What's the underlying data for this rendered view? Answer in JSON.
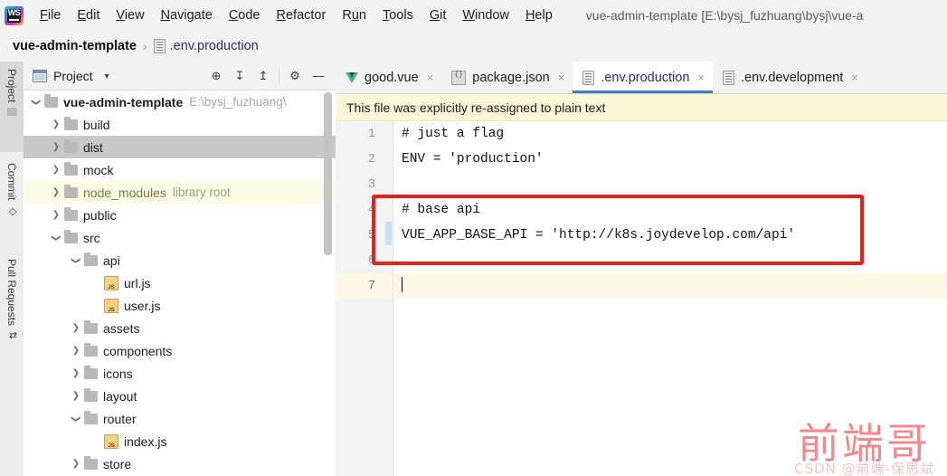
{
  "window": {
    "title": "vue-admin-template [E:\\bysj_fuzhuang\\bysj\\vue-a",
    "app_icon": "webstorm-icon"
  },
  "menubar": {
    "items": [
      {
        "label": "File",
        "mnemonic": "F"
      },
      {
        "label": "Edit",
        "mnemonic": "E"
      },
      {
        "label": "View",
        "mnemonic": "V"
      },
      {
        "label": "Navigate",
        "mnemonic": "N"
      },
      {
        "label": "Code",
        "mnemonic": "C"
      },
      {
        "label": "Refactor",
        "mnemonic": "R"
      },
      {
        "label": "Run",
        "mnemonic": "u"
      },
      {
        "label": "Tools",
        "mnemonic": "T"
      },
      {
        "label": "Git",
        "mnemonic": "G"
      },
      {
        "label": "Window",
        "mnemonic": "W"
      },
      {
        "label": "Help",
        "mnemonic": "H"
      }
    ]
  },
  "breadcrumb": {
    "project": "vue-admin-template",
    "separator": "›",
    "file": ".env.production"
  },
  "toolstrip": {
    "tabs": [
      {
        "label": "Project",
        "icon": "folder-icon",
        "active": true
      },
      {
        "label": "Commit",
        "icon": "commit-icon",
        "active": false
      },
      {
        "label": "Pull Requests",
        "icon": "pull-request-icon",
        "active": false
      }
    ]
  },
  "project_panel": {
    "title": "Project",
    "caret": "▼",
    "actions": [
      {
        "name": "locate-icon",
        "glyph": "⊕"
      },
      {
        "name": "expand-all-icon",
        "glyph": "↧"
      },
      {
        "name": "collapse-all-icon",
        "glyph": "↥"
      },
      {
        "name": "settings-gear-icon",
        "glyph": "⚙"
      },
      {
        "name": "hide-panel-icon",
        "glyph": "—"
      }
    ],
    "tree": [
      {
        "label": "vue-admin-template",
        "hint": "E:\\bysj_fuzhuang\\",
        "indent": 0,
        "type": "folder",
        "arrow": "down",
        "bold": true,
        "state": "normal"
      },
      {
        "label": "build",
        "hint": "",
        "indent": 1,
        "type": "folder",
        "arrow": "right",
        "bold": false,
        "state": "normal"
      },
      {
        "label": "dist",
        "hint": "",
        "indent": 1,
        "type": "folder",
        "arrow": "right",
        "bold": false,
        "state": "selected"
      },
      {
        "label": "mock",
        "hint": "",
        "indent": 1,
        "type": "folder",
        "arrow": "right",
        "bold": false,
        "state": "normal"
      },
      {
        "label": "node_modules",
        "hint": "library root",
        "indent": 1,
        "type": "folder",
        "arrow": "right",
        "bold": false,
        "state": "library"
      },
      {
        "label": "public",
        "hint": "",
        "indent": 1,
        "type": "folder",
        "arrow": "right",
        "bold": false,
        "state": "normal"
      },
      {
        "label": "src",
        "hint": "",
        "indent": 1,
        "type": "folder",
        "arrow": "down",
        "bold": false,
        "state": "normal"
      },
      {
        "label": "api",
        "hint": "",
        "indent": 2,
        "type": "folder",
        "arrow": "down",
        "bold": false,
        "state": "normal"
      },
      {
        "label": "url.js",
        "hint": "",
        "indent": 3,
        "type": "js",
        "arrow": "none",
        "bold": false,
        "state": "normal"
      },
      {
        "label": "user.js",
        "hint": "",
        "indent": 3,
        "type": "js",
        "arrow": "none",
        "bold": false,
        "state": "normal"
      },
      {
        "label": "assets",
        "hint": "",
        "indent": 2,
        "type": "folder",
        "arrow": "right",
        "bold": false,
        "state": "normal"
      },
      {
        "label": "components",
        "hint": "",
        "indent": 2,
        "type": "folder",
        "arrow": "right",
        "bold": false,
        "state": "normal"
      },
      {
        "label": "icons",
        "hint": "",
        "indent": 2,
        "type": "folder",
        "arrow": "right",
        "bold": false,
        "state": "normal"
      },
      {
        "label": "layout",
        "hint": "",
        "indent": 2,
        "type": "folder",
        "arrow": "right",
        "bold": false,
        "state": "normal"
      },
      {
        "label": "router",
        "hint": "",
        "indent": 2,
        "type": "folder",
        "arrow": "down",
        "bold": false,
        "state": "normal"
      },
      {
        "label": "index.js",
        "hint": "",
        "indent": 3,
        "type": "js",
        "arrow": "none",
        "bold": false,
        "state": "normal"
      },
      {
        "label": "store",
        "hint": "",
        "indent": 2,
        "type": "folder",
        "arrow": "right",
        "bold": false,
        "state": "normal"
      }
    ]
  },
  "editor": {
    "tabs": [
      {
        "label": "good.vue",
        "icon": "vue-icon",
        "active": false,
        "close": "×"
      },
      {
        "label": "package.json",
        "icon": "json-icon",
        "active": false,
        "close": "×"
      },
      {
        "label": ".env.production",
        "icon": "text-file-icon",
        "active": true,
        "close": "×"
      },
      {
        "label": ".env.development",
        "icon": "text-file-icon",
        "active": false,
        "close": "×"
      }
    ],
    "notification": "This file was explicitly re-assigned to plain text",
    "line_numbers": [
      "1",
      "2",
      "3",
      "4",
      "5",
      "6",
      "7"
    ],
    "lines": [
      "# just a flag",
      "ENV = 'production'",
      "",
      "# base api",
      "VUE_APP_BASE_API = 'http://k8s.joydevelop.com/api'",
      "",
      ""
    ],
    "caret_line": 7,
    "highlight_box_color": "#e8211a"
  },
  "watermark": {
    "big": "前端哥",
    "small": "CSDN @前端-保思斌"
  }
}
